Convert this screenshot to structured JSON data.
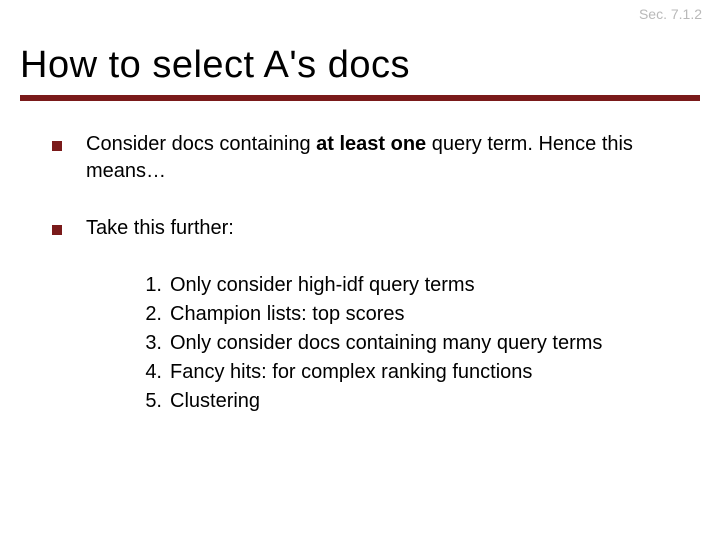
{
  "section_label": "Sec. 7.1.2",
  "title": "How to select A's docs",
  "bullets": [
    {
      "pre": "Consider docs containing ",
      "bold": "at least one",
      "post": " query term. Hence this means…"
    },
    {
      "pre": "Take this further:",
      "bold": "",
      "post": ""
    }
  ],
  "numbered": [
    "Only consider high-idf query terms",
    "Champion lists: top scores",
    "Only consider docs containing many query terms",
    "Fancy hits: for complex ranking functions",
    "Clustering"
  ],
  "numbers": [
    "1.",
    "2.",
    "3.",
    "4.",
    "5."
  ]
}
